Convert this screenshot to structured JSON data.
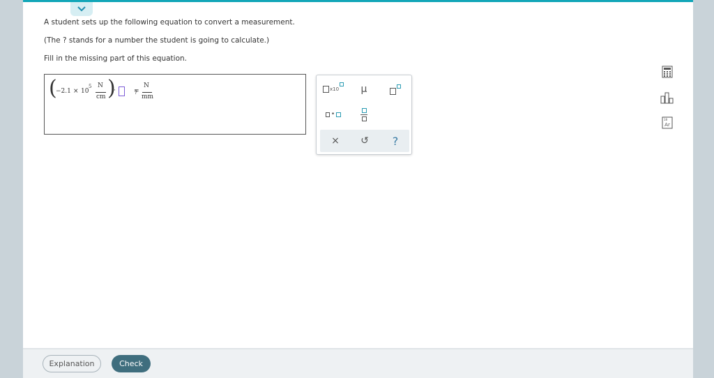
{
  "question": {
    "line1": "A student sets up the following equation to convert a measurement.",
    "line2": "(The ? stands for a number the student is going to calculate.)",
    "line3": "Fill in the missing part of this equation."
  },
  "equation": {
    "coefficient": "−2.1",
    "times": "×",
    "base": "10",
    "exponent": "5",
    "numerator_unit": "N",
    "denominator_unit": "cm",
    "dot": "·",
    "equals": "=",
    "result": "?",
    "result_numerator": "N",
    "result_denominator": "mm"
  },
  "toolbox": {
    "mu_label": "μ",
    "x10_label": "x10",
    "clear_label": "×",
    "undo_label": "↺",
    "help_label": "?"
  },
  "footer": {
    "explanation_label": "Explanation",
    "check_label": "Check"
  },
  "side_icons": {
    "first": "calculator-icon",
    "second": "bar-chart-icon",
    "third": "periodic-table-icon",
    "periodic_label": "Ar"
  },
  "colors": {
    "accent": "#12a6b8",
    "check_button": "#3f6e7e",
    "placeholder_slot": "#7c5cd6"
  }
}
